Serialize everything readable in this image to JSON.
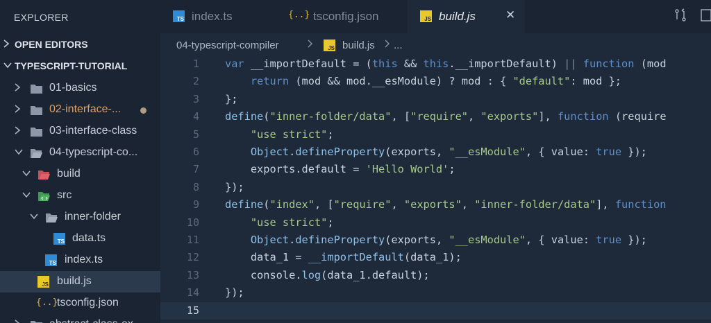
{
  "sidebar": {
    "title": "EXPLORER",
    "sections": {
      "open_editors": "OPEN EDITORS",
      "project": "TYPESCRIPT-TUTORIAL"
    },
    "items": [
      {
        "label": "01-basics"
      },
      {
        "label": "02-interface-..."
      },
      {
        "label": "03-interface-class"
      },
      {
        "label": "04-typescript-co..."
      },
      {
        "label": "build"
      },
      {
        "label": "src"
      },
      {
        "label": "inner-folder"
      },
      {
        "label": "data.ts"
      },
      {
        "label": "index.ts"
      },
      {
        "label": "build.js"
      },
      {
        "label": "tsconfig.json"
      },
      {
        "label": "abstract-class-ex"
      }
    ],
    "icons": {
      "ts": "TS",
      "js": "JS",
      "json": "{..}"
    }
  },
  "tabs": [
    {
      "label": "index.ts",
      "icon": "TS"
    },
    {
      "label": "tsconfig.json",
      "icon": "{..}"
    },
    {
      "label": "build.js",
      "icon": "JS",
      "close": "✕"
    }
  ],
  "breadcrumb": {
    "folder": "04-typescript-compiler",
    "file": "build.js",
    "trail": "..."
  },
  "editor": {
    "line_numbers": [
      "1",
      "2",
      "3",
      "4",
      "5",
      "6",
      "7",
      "8",
      "9",
      "10",
      "11",
      "12",
      "13",
      "14",
      "15"
    ],
    "active_line": "15"
  }
}
